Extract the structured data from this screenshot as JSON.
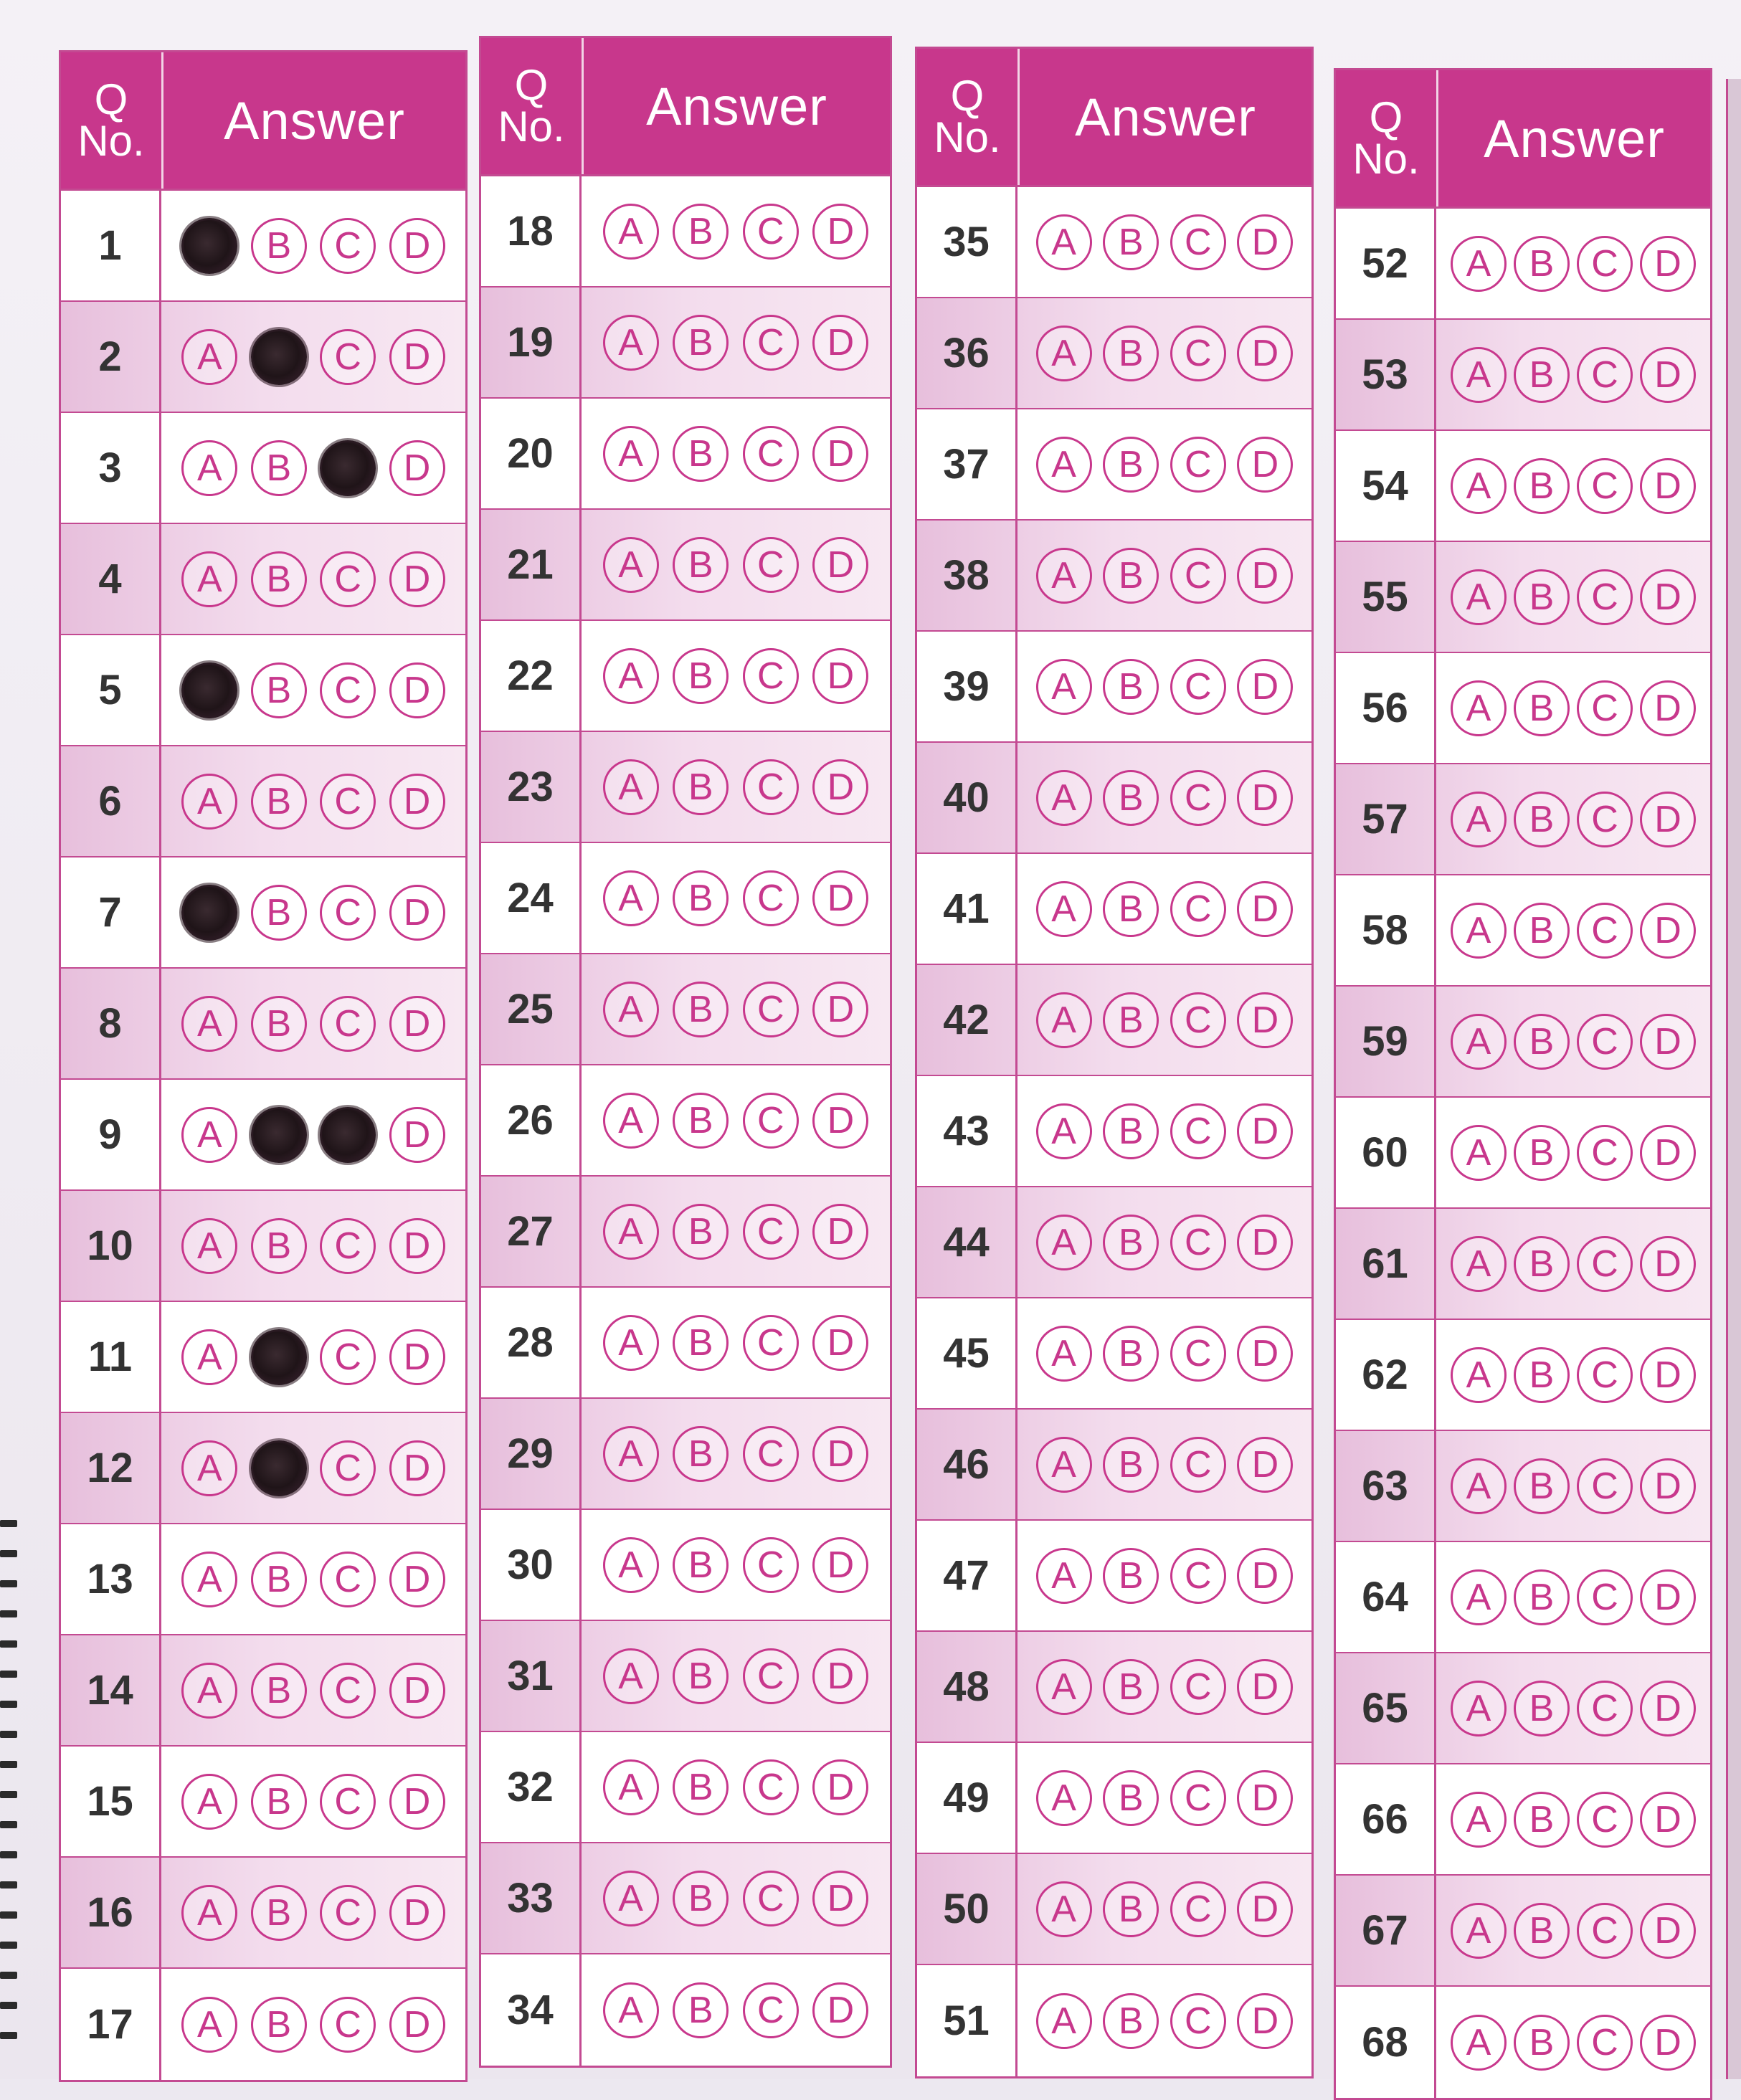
{
  "header": {
    "q_line1": "Q",
    "q_line2": "No.",
    "answer": "Answer"
  },
  "options": [
    "A",
    "B",
    "C",
    "D"
  ],
  "accent_color": "#c8378c",
  "columns": [
    {
      "questions": [
        {
          "no": "1",
          "marked": [
            "A"
          ]
        },
        {
          "no": "2",
          "marked": [
            "B"
          ]
        },
        {
          "no": "3",
          "marked": [
            "C"
          ]
        },
        {
          "no": "4",
          "marked": []
        },
        {
          "no": "5",
          "marked": [
            "A"
          ]
        },
        {
          "no": "6",
          "marked": []
        },
        {
          "no": "7",
          "marked": [
            "A"
          ]
        },
        {
          "no": "8",
          "marked": []
        },
        {
          "no": "9",
          "marked": [
            "B",
            "C"
          ]
        },
        {
          "no": "10",
          "marked": []
        },
        {
          "no": "11",
          "marked": [
            "B"
          ]
        },
        {
          "no": "12",
          "marked": [
            "B"
          ]
        },
        {
          "no": "13",
          "marked": []
        },
        {
          "no": "14",
          "marked": []
        },
        {
          "no": "15",
          "marked": []
        },
        {
          "no": "16",
          "marked": []
        },
        {
          "no": "17",
          "marked": []
        }
      ]
    },
    {
      "questions": [
        {
          "no": "18",
          "marked": []
        },
        {
          "no": "19",
          "marked": []
        },
        {
          "no": "20",
          "marked": []
        },
        {
          "no": "21",
          "marked": []
        },
        {
          "no": "22",
          "marked": []
        },
        {
          "no": "23",
          "marked": []
        },
        {
          "no": "24",
          "marked": []
        },
        {
          "no": "25",
          "marked": []
        },
        {
          "no": "26",
          "marked": []
        },
        {
          "no": "27",
          "marked": []
        },
        {
          "no": "28",
          "marked": []
        },
        {
          "no": "29",
          "marked": []
        },
        {
          "no": "30",
          "marked": []
        },
        {
          "no": "31",
          "marked": []
        },
        {
          "no": "32",
          "marked": []
        },
        {
          "no": "33",
          "marked": []
        },
        {
          "no": "34",
          "marked": []
        }
      ]
    },
    {
      "questions": [
        {
          "no": "35",
          "marked": []
        },
        {
          "no": "36",
          "marked": []
        },
        {
          "no": "37",
          "marked": []
        },
        {
          "no": "38",
          "marked": []
        },
        {
          "no": "39",
          "marked": []
        },
        {
          "no": "40",
          "marked": []
        },
        {
          "no": "41",
          "marked": []
        },
        {
          "no": "42",
          "marked": []
        },
        {
          "no": "43",
          "marked": []
        },
        {
          "no": "44",
          "marked": []
        },
        {
          "no": "45",
          "marked": []
        },
        {
          "no": "46",
          "marked": []
        },
        {
          "no": "47",
          "marked": []
        },
        {
          "no": "48",
          "marked": []
        },
        {
          "no": "49",
          "marked": []
        },
        {
          "no": "50",
          "marked": []
        },
        {
          "no": "51",
          "marked": []
        }
      ]
    },
    {
      "questions": [
        {
          "no": "52",
          "marked": []
        },
        {
          "no": "53",
          "marked": []
        },
        {
          "no": "54",
          "marked": []
        },
        {
          "no": "55",
          "marked": []
        },
        {
          "no": "56",
          "marked": []
        },
        {
          "no": "57",
          "marked": []
        },
        {
          "no": "58",
          "marked": []
        },
        {
          "no": "59",
          "marked": []
        },
        {
          "no": "60",
          "marked": []
        },
        {
          "no": "61",
          "marked": []
        },
        {
          "no": "62",
          "marked": []
        },
        {
          "no": "63",
          "marked": []
        },
        {
          "no": "64",
          "marked": []
        },
        {
          "no": "65",
          "marked": []
        },
        {
          "no": "66",
          "marked": []
        },
        {
          "no": "67",
          "marked": []
        },
        {
          "no": "68",
          "marked": []
        }
      ]
    }
  ]
}
